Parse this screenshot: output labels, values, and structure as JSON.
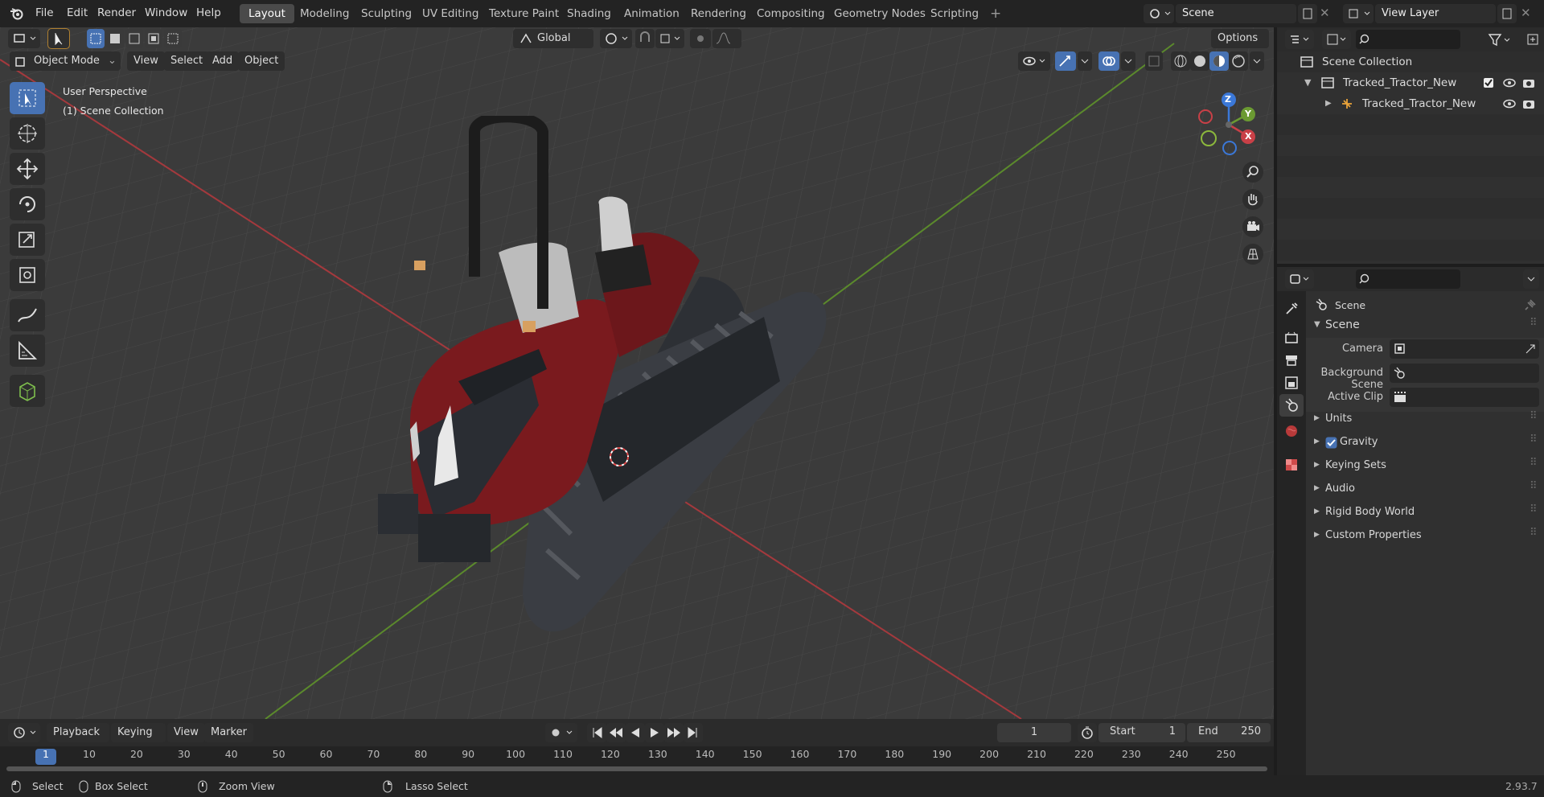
{
  "menu": [
    "File",
    "Edit",
    "Render",
    "Window",
    "Help"
  ],
  "workspaces": [
    "Layout",
    "Modeling",
    "Sculpting",
    "UV Editing",
    "Texture Paint",
    "Shading",
    "Animation",
    "Rendering",
    "Compositing",
    "Geometry Nodes",
    "Scripting"
  ],
  "active_workspace": "Layout",
  "scene_field": "Scene",
  "view_layer_field": "View Layer",
  "viewport": {
    "transform_orientation": "Global",
    "options_label": "Options",
    "mode": "Object Mode",
    "header_menus": [
      "View",
      "Select",
      "Add",
      "Object"
    ],
    "overlay_text_1": "User Perspective",
    "overlay_text_2": "(1) Scene Collection",
    "gizmo": {
      "z": "Z",
      "y": "Y",
      "x": "X"
    }
  },
  "outliner": {
    "root": "Scene Collection",
    "items": [
      {
        "label": "Tracked_Tractor_New"
      },
      {
        "label": "Tracked_Tractor_New"
      }
    ]
  },
  "properties": {
    "context_label": "Scene",
    "panel_title": "Scene",
    "fields": [
      {
        "label": "Camera"
      },
      {
        "label": "Background Scene"
      },
      {
        "label": "Active Clip"
      }
    ],
    "sections": [
      "Units",
      "Gravity",
      "Keying Sets",
      "Audio",
      "Rigid Body World",
      "Custom Properties"
    ]
  },
  "timeline": {
    "menus": [
      "Playback",
      "Keying",
      "View",
      "Marker"
    ],
    "current_frame": "1",
    "start_label": "Start",
    "start_value": "1",
    "end_label": "End",
    "end_value": "250",
    "ticks": [
      "1",
      "10",
      "20",
      "30",
      "40",
      "50",
      "60",
      "70",
      "80",
      "90",
      "100",
      "110",
      "120",
      "130",
      "140",
      "150",
      "160",
      "170",
      "180",
      "190",
      "200",
      "210",
      "220",
      "230",
      "240",
      "250"
    ]
  },
  "statusbar": {
    "select": "Select",
    "box_select": "Box Select",
    "zoom_view": "Zoom View",
    "lasso_select": "Lasso Select",
    "version": "2.93.7"
  },
  "colors": {
    "accent": "#4772b3",
    "x_axis": "#c94047",
    "y_axis": "#6b9a32",
    "tractor_red": "#7a1a1e"
  }
}
